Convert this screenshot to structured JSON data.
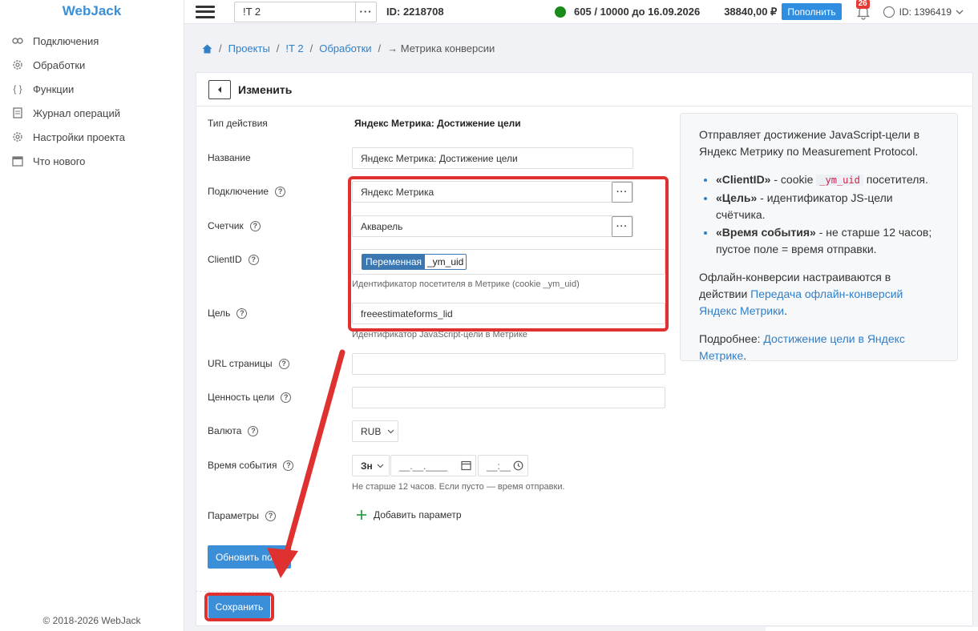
{
  "app": {
    "brand": "WebJack",
    "copyright": "© 2018-2026 WebJack"
  },
  "sidebar": {
    "items": [
      {
        "label": "Подключения",
        "icon": "link-icon"
      },
      {
        "label": "Обработки",
        "icon": "gear-icon"
      },
      {
        "label": "Функции",
        "icon": "braces-icon"
      },
      {
        "label": "Журнал операций",
        "icon": "document-icon"
      },
      {
        "label": "Настройки проекта",
        "icon": "gear-icon"
      },
      {
        "label": "Что нового",
        "icon": "calendar-icon"
      }
    ]
  },
  "topbar": {
    "project": "!T        2",
    "project_id": "ID: 2218708",
    "limit": "605 / 10000 до 16.09.2026",
    "balance": "38840,00 ₽",
    "topup_label": "Пополнить",
    "notifications": "26",
    "user_id": "ID: 1396419"
  },
  "breadcrumb": {
    "projects": "Проекты",
    "project": "!T        2",
    "handlers": "Обработки",
    "current": "→ Метрика конверсии",
    "sep": "/"
  },
  "form": {
    "title": "Изменить",
    "action_type_label": "Тип действия",
    "action_type_value": "Яндекс Метрика: Достижение цели",
    "name_label": "Название",
    "name_value": "Яндекс Метрика: Достижение цели",
    "connection_label": "Подключение",
    "connection_value": "Яндекс Метрика",
    "counter_label": "Счетчик",
    "counter_value": "Акварель",
    "clientid_label": "ClientID",
    "clientid_chip_key": "Переменная",
    "clientid_chip_value": "_ym_uid",
    "clientid_hint": "Идентификатор посетителя в Метрике (cookie _ym_uid)",
    "goal_label": "Цель",
    "goal_value": "freeestimateforms_lid",
    "goal_hint": "Идентификатор JavaScript-цели в Метрике",
    "url_label": "URL страницы",
    "url_value": "",
    "goal_value_label": "Ценность цели",
    "goal_value_value": "",
    "currency_label": "Валюта",
    "currency_value": "RUB",
    "event_time_label": "Время события",
    "event_time_mode": "Зн",
    "event_date_placeholder": "__.__.____",
    "event_time_placeholder": "__:__",
    "event_time_hint": "Не старше 12 часов. Если пусто — время отправки.",
    "params_label": "Параметры",
    "add_param_label": "Добавить параметр",
    "update_fields_label": "Обновить поля",
    "save_label": "Сохранить",
    "help": "?"
  },
  "info": {
    "intro": "Отправляет достижение JavaScript-цели в Яндекс Метрику по Measurement Protocol.",
    "b1_key": "«ClientID»",
    "b1_text_a": " - cookie ",
    "b1_code": "_ym_uid",
    "b1_text_b": " посетителя.",
    "b2_key": "«Цель»",
    "b2_text": " - идентификатор JS-цели счётчика.",
    "b3_key": "«Время события»",
    "b3_text": " - не старше 12 часов; пустое поле = время отправки.",
    "offline_text": "Офлайн-конверсии настраиваются в действии ",
    "offline_link": "Передача офлайн-конверсий Яндекс Метрики",
    "offline_end": ".",
    "more_text": "Подробнее: ",
    "more_link": "Достижение цели в Яндекс Метрике",
    "more_end": "."
  },
  "colors": {
    "accent": "#3b8fd8",
    "annotation": "#e03131",
    "status_ok": "#1a8a1a"
  }
}
